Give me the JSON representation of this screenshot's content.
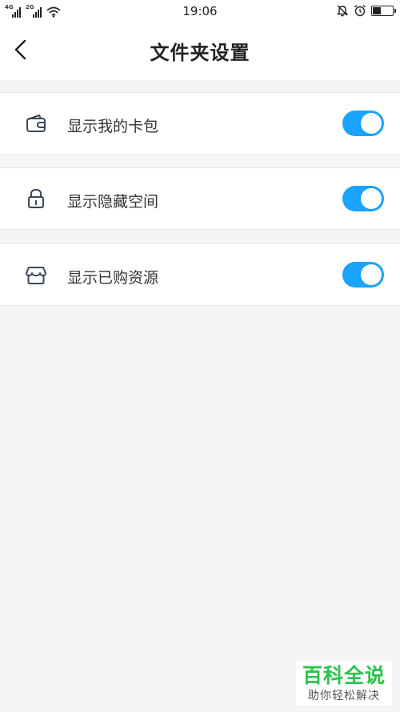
{
  "status_bar": {
    "time": "19:06",
    "network_1": "4G",
    "network_2": "2G",
    "battery_level": 0.45,
    "icons": [
      "signal-icon",
      "wifi-icon",
      "mute-bell-icon",
      "alarm-icon",
      "battery-icon"
    ]
  },
  "header": {
    "title": "文件夹设置",
    "back_icon": "back-chevron-icon"
  },
  "settings": [
    {
      "icon": "wallet-icon",
      "label": "显示我的卡包",
      "enabled": true
    },
    {
      "icon": "lock-icon",
      "label": "显示隐藏空间",
      "enabled": true
    },
    {
      "icon": "store-icon",
      "label": "显示已购资源",
      "enabled": true
    }
  ],
  "colors": {
    "accent": "#1aa3ff",
    "page_bg": "#f4f5f7",
    "watermark_green": "#2ac24a"
  },
  "watermark": {
    "title": "百科全说",
    "subtitle": "助你轻松解决"
  }
}
